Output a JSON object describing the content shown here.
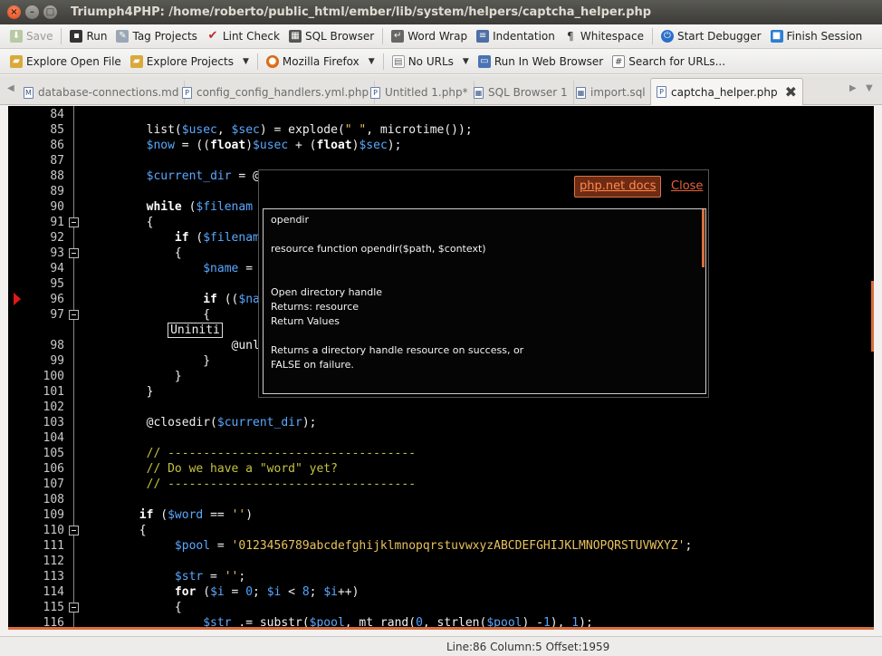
{
  "window": {
    "title": "Triumph4PHP: /home/roberto/public_html/ember/lib/system/helpers/captcha_helper.php"
  },
  "toolbar1": {
    "save": "Save",
    "run": "Run",
    "tag_projects": "Tag Projects",
    "lint_check": "Lint Check",
    "sql_browser": "SQL Browser",
    "word_wrap": "Word Wrap",
    "indentation": "Indentation",
    "whitespace": "Whitespace",
    "start_debugger": "Start Debugger",
    "finish_session": "Finish Session"
  },
  "toolbar2": {
    "explore_open_file": "Explore Open File",
    "explore_projects": "Explore Projects",
    "mozilla_firefox": "Mozilla Firefox",
    "no_urls": "No URLs",
    "run_in_web_browser": "Run In Web Browser",
    "search_for_urls": "Search for URLs..."
  },
  "tabs": [
    {
      "label": "database-connections.md"
    },
    {
      "label": "config_config_handlers.yml.php"
    },
    {
      "label": "Untitled 1.php*"
    },
    {
      "label": "SQL Browser 1"
    },
    {
      "label": "import.sql"
    },
    {
      "label": "captcha_helper.php"
    }
  ],
  "editor": {
    "line_numbers": [
      "84",
      "85",
      "86",
      "87",
      "88",
      "89",
      "90",
      "91",
      "92",
      "93",
      "94",
      "95",
      "96",
      "97",
      "",
      "98",
      "99",
      "100",
      "101",
      "102",
      "103",
      "104",
      "105",
      "106",
      "107",
      "108",
      "109",
      "110",
      "111",
      "112",
      "113",
      "114",
      "115",
      "116"
    ],
    "lines": [
      "",
      "        list($usec, $sec) = explode(\" \", microtime());",
      "        $now = ((float)$usec + (float)$sec);",
      "",
      "        $current_dir = @",
      "",
      "        while ($filenam",
      "        {",
      "            if ($filenam",
      "            {",
      "                $name = ",
      "",
      "                if (($na",
      "                {",
      "                 Uniniti",
      "                    @unl",
      "                }",
      "            }",
      "        }",
      "",
      "        @closedir($current_dir);",
      "",
      "        // -----------------------------------",
      "        // Do we have a \"word\" yet?",
      "        // -----------------------------------",
      "",
      "       if ($word == '')",
      "       {",
      "            $pool = '0123456789abcdefghijklmnopqrstuvwxyzABCDEFGHIJKLMNOPQRSTUVWXYZ';",
      "",
      "            $str = '';",
      "            for ($i = 0; $i < 8; $i++)",
      "            {",
      "                $str .= substr($pool, mt_rand(0, strlen($pool) -1), 1);"
    ]
  },
  "popup": {
    "docs_button": "php.net docs",
    "close_link": "Close",
    "function_name": "opendir",
    "signature": "resource function opendir($path, $context)",
    "summary": "Open directory handle",
    "returns": "Returns: resource",
    "return_values_heading": "Return Values",
    "return_desc_1": "Returns a directory handle resource on success, or",
    "return_desc_2": "FALSE on failure."
  },
  "status": {
    "position": "Line:86 Column:5 Offset:1959"
  }
}
